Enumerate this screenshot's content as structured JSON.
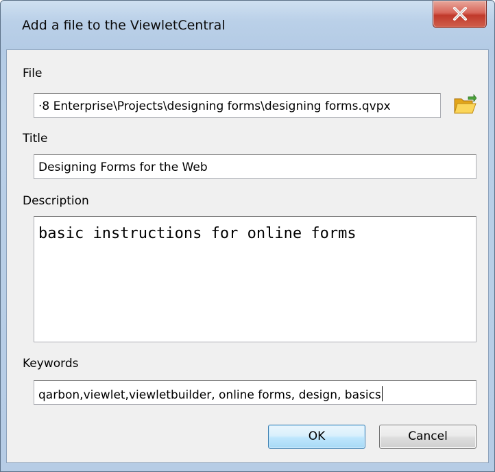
{
  "window": {
    "title": "Add a file to the ViewletCentral",
    "close_glyph": "X"
  },
  "form": {
    "file_label": "File",
    "file_value": "·8 Enterprise\\Projects\\designing forms\\designing forms.qvpx",
    "title_label": "Title",
    "title_value": "Designing Forms for the Web",
    "description_label": "Description",
    "description_value": "basic instructions for online forms",
    "keywords_label": "Keywords",
    "keywords_value": "qarbon,viewlet,viewletbuilder, online forms, design, basics"
  },
  "buttons": {
    "ok_label": "OK",
    "cancel_label": "Cancel"
  },
  "icons": {
    "close": "close-icon",
    "browse": "folder-open-icon"
  },
  "colors": {
    "close_red": "#c0392b",
    "ok_border": "#3c7fb1",
    "frame_blue": "#b9cfe7"
  }
}
